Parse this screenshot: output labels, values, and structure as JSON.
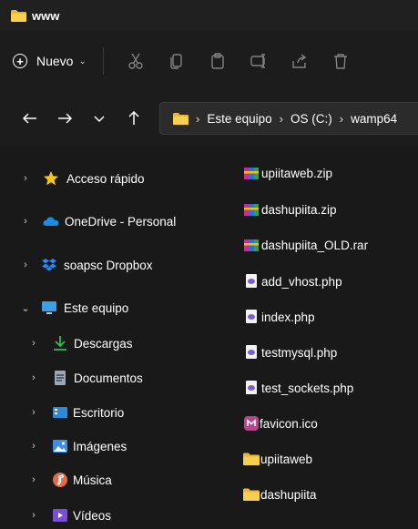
{
  "window": {
    "title": "www"
  },
  "toolbar": {
    "new_label": "Nuevo",
    "icons": [
      "cut-icon",
      "copy-icon",
      "paste-icon",
      "rename-icon",
      "share-icon",
      "delete-icon"
    ]
  },
  "address": {
    "nav_icons": [
      "back-icon",
      "forward-icon",
      "recent-icon",
      "up-icon"
    ],
    "crumbs": [
      "Este equipo",
      "OS (C:)",
      "wamp64"
    ]
  },
  "nav_pane": {
    "items": [
      {
        "label": "Acceso rápido",
        "icon": "star-icon",
        "color": "#f2c40f"
      },
      {
        "label": "OneDrive - Personal",
        "icon": "cloud-icon",
        "color": "#1f8fe6"
      },
      {
        "label": "soapsc Dropbox",
        "icon": "dropbox-icon",
        "color": "#2f87f5"
      },
      {
        "label": "Este equipo",
        "icon": "computer-icon",
        "color": "#3aa0e8"
      },
      {
        "label": "Descargas",
        "icon": "download-icon",
        "color": "#36b85b"
      },
      {
        "label": "Documentos",
        "icon": "documents-icon",
        "color": "#9aa7b4"
      },
      {
        "label": "Escritorio",
        "icon": "desktop-icon",
        "color": "#2d8ad8"
      },
      {
        "label": "Imágenes",
        "icon": "pictures-icon",
        "color": "#3c8fe2"
      },
      {
        "label": "Música",
        "icon": "music-icon",
        "color": "#e36b4c"
      },
      {
        "label": "Vídeos",
        "icon": "videos-icon",
        "color": "#7c4ed6"
      }
    ]
  },
  "files": [
    {
      "name": "upiitaweb.zip",
      "type": "archive"
    },
    {
      "name": "dashupiita.zip",
      "type": "archive"
    },
    {
      "name": "dashupiita_OLD.rar",
      "type": "archive"
    },
    {
      "name": "add_vhost.php",
      "type": "php"
    },
    {
      "name": "index.php",
      "type": "php"
    },
    {
      "name": "testmysql.php",
      "type": "php"
    },
    {
      "name": "test_sockets.php",
      "type": "php"
    },
    {
      "name": "favicon.ico",
      "type": "ico"
    },
    {
      "name": "upiitaweb",
      "type": "folder"
    },
    {
      "name": "dashupiita",
      "type": "folder"
    }
  ]
}
